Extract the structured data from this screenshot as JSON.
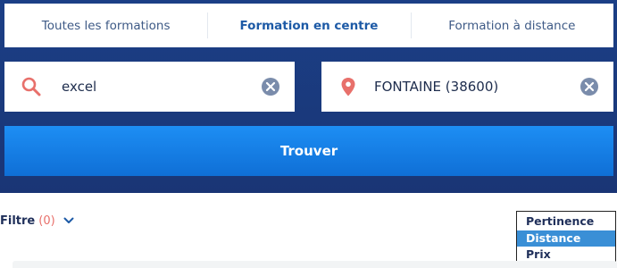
{
  "tabs": [
    {
      "label": "Toutes les formations",
      "active": false
    },
    {
      "label": "Formation en centre",
      "active": true
    },
    {
      "label": "Formation à distance",
      "active": false
    }
  ],
  "search": {
    "value": "excel",
    "icon": "search-icon",
    "clear_icon": "clear-icon"
  },
  "location": {
    "value": "FONTAINE (38600)",
    "icon": "location-pin-icon",
    "clear_icon": "clear-icon"
  },
  "find_button": {
    "label": "Trouver"
  },
  "filter": {
    "label": "Filtre",
    "count": "(0)",
    "icon": "chevron-down-icon"
  },
  "sort": {
    "options": [
      "Pertinence",
      "Distance",
      "Prix"
    ],
    "selected": "Distance"
  },
  "colors": {
    "hero": "#1b3f86",
    "button": "#1580e6",
    "accent_red": "#e8706b",
    "selected_option": "#3a8fd6"
  }
}
